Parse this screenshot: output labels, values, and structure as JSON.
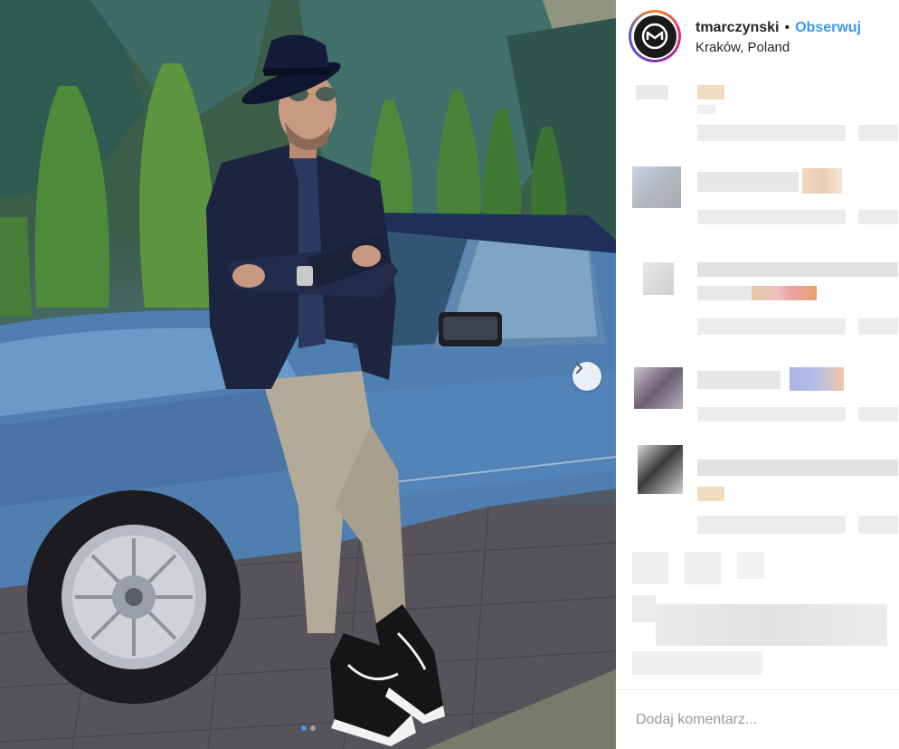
{
  "post": {
    "username": "tmarczynski",
    "separator": "•",
    "follow_label": "Obserwuj",
    "location": "Kraków, Poland"
  },
  "carousel": {
    "slide_count": 2,
    "active_slide": 1,
    "next_icon": "chevron-right-icon"
  },
  "comment_box": {
    "placeholder": "Dodaj komentarz..."
  },
  "colors": {
    "link_blue": "#3897f0",
    "text": "#262626",
    "border": "#efefef"
  }
}
